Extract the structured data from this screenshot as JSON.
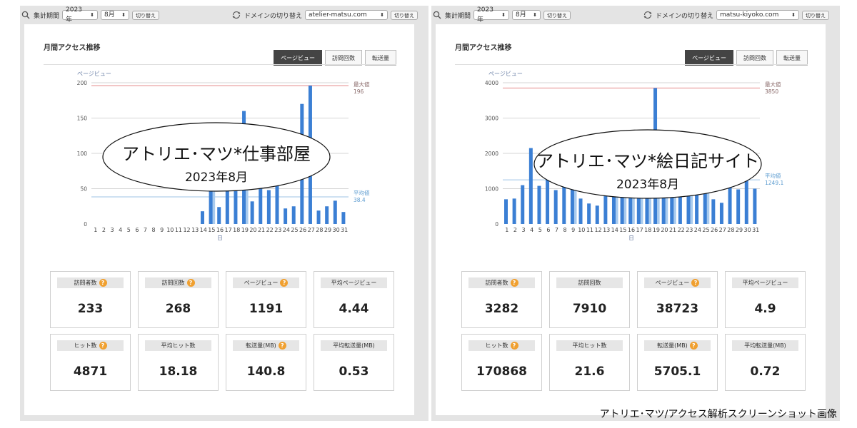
{
  "caption": "アトリエ･マツ/アクセス解析スクリーンショット画像",
  "colors": {
    "bar": "#3b7fd4",
    "bar_light": "#a9cbee",
    "max_line": "#e58c8c",
    "avg_line": "#9cc3e6",
    "help": "#f0a030",
    "tab_active": "#444444"
  },
  "panels": [
    {
      "period_label": "集計期間",
      "year": "2023年",
      "month": "8月",
      "switch_btn": "切り替え",
      "domain_label": "ドメインの切り替え",
      "domain": "atelier-matsu.com",
      "domain_btn": "切り替え",
      "section_title": "月間アクセス推移",
      "tabs": [
        "ページビュー",
        "訪問回数",
        "転送量"
      ],
      "stats": [
        {
          "label": "訪問者数",
          "value": "233",
          "help": true
        },
        {
          "label": "訪問回数",
          "value": "268",
          "help": true
        },
        {
          "label": "ページビュー",
          "value": "1191",
          "help": true
        },
        {
          "label": "平均ページビュー",
          "value": "4.44",
          "help": false
        },
        {
          "label": "ヒット数",
          "value": "4871",
          "help": true
        },
        {
          "label": "平均ヒット数",
          "value": "18.18",
          "help": false
        },
        {
          "label": "転送量(MB)",
          "value": "140.8",
          "help": true
        },
        {
          "label": "平均転送量(MB)",
          "value": "0.53",
          "help": false
        }
      ],
      "overlay": {
        "title": "アトリエ･マツ*仕事部屋",
        "subtitle": "2023年8月"
      }
    },
    {
      "period_label": "集計期間",
      "year": "2023年",
      "month": "8月",
      "switch_btn": "切り替え",
      "domain_label": "ドメインの切り替え",
      "domain": "matsu-kiyoko.com",
      "domain_btn": "切り替え",
      "section_title": "月間アクセス推移",
      "tabs": [
        "ページビュー",
        "訪問回数",
        "転送量"
      ],
      "stats": [
        {
          "label": "訪問者数",
          "value": "3282",
          "help": true
        },
        {
          "label": "訪問回数",
          "value": "7910",
          "help": true
        },
        {
          "label": "ページビュー",
          "value": "38723",
          "help": true
        },
        {
          "label": "平均ページビュー",
          "value": "4.9",
          "help": false
        },
        {
          "label": "ヒット数",
          "value": "170868",
          "help": true
        },
        {
          "label": "平均ヒット数",
          "value": "21.6",
          "help": false
        },
        {
          "label": "転送量(MB)",
          "value": "5705.1",
          "help": true
        },
        {
          "label": "平均転送量(MB)",
          "value": "0.72",
          "help": false
        }
      ],
      "overlay": {
        "title": "アトリエ･マツ*絵日記サイト",
        "subtitle": "2023年8月"
      }
    }
  ],
  "chart_data": [
    {
      "type": "bar",
      "ylabel": "ページビュー",
      "xlabel": "日",
      "ylim": [
        0,
        200
      ],
      "yticks": [
        0,
        50,
        100,
        150,
        200
      ],
      "categories": [
        "1",
        "2",
        "3",
        "4",
        "5",
        "6",
        "7",
        "8",
        "9",
        "10",
        "11",
        "12",
        "13",
        "14",
        "15",
        "16",
        "17",
        "18",
        "19",
        "20",
        "21",
        "22",
        "23",
        "24",
        "25",
        "26",
        "27",
        "28",
        "29",
        "30",
        "31"
      ],
      "values": [
        0,
        0,
        0,
        0,
        0,
        0,
        0,
        0,
        0,
        0,
        0,
        0,
        0,
        18,
        110,
        24,
        48,
        78,
        160,
        32,
        64,
        48,
        82,
        22,
        25,
        170,
        196,
        19,
        25,
        33,
        17
      ],
      "secondary_values": [
        0,
        0,
        0,
        0,
        0,
        0,
        0,
        0,
        0,
        0,
        0,
        0,
        0,
        0,
        105,
        0,
        0,
        0,
        105,
        0,
        0,
        0,
        0,
        0,
        0,
        0,
        0,
        0,
        0,
        0,
        0
      ],
      "max": {
        "label": "最大値",
        "value": 196
      },
      "avg": {
        "label": "平均値",
        "value": 38.4
      }
    },
    {
      "type": "bar",
      "ylabel": "ページビュー",
      "xlabel": "日",
      "ylim": [
        0,
        4000
      ],
      "yticks": [
        0,
        1000,
        2000,
        3000,
        4000
      ],
      "categories": [
        "1",
        "2",
        "3",
        "4",
        "5",
        "6",
        "7",
        "8",
        "9",
        "10",
        "11",
        "12",
        "13",
        "14",
        "15",
        "16",
        "17",
        "18",
        "19",
        "20",
        "21",
        "22",
        "23",
        "24",
        "25",
        "26",
        "27",
        "28",
        "29",
        "30",
        "31"
      ],
      "values": [
        700,
        720,
        1100,
        2150,
        1080,
        1420,
        960,
        1130,
        1200,
        720,
        580,
        520,
        1120,
        1000,
        1000,
        1000,
        1000,
        1010,
        3850,
        990,
        990,
        990,
        990,
        880,
        1000,
        700,
        600,
        1100,
        980,
        1300,
        1000
      ],
      "secondary_values": [
        0,
        0,
        0,
        0,
        0,
        0,
        0,
        0,
        1430,
        0,
        0,
        0,
        0,
        1500,
        1500,
        1000,
        1300,
        1300,
        1500,
        1500,
        1450,
        0,
        1500,
        0,
        1350,
        0,
        0,
        0,
        0,
        0,
        0
      ],
      "max": {
        "label": "最大値",
        "value": 3850
      },
      "avg": {
        "label": "平均値",
        "value": 1249.1
      }
    }
  ]
}
